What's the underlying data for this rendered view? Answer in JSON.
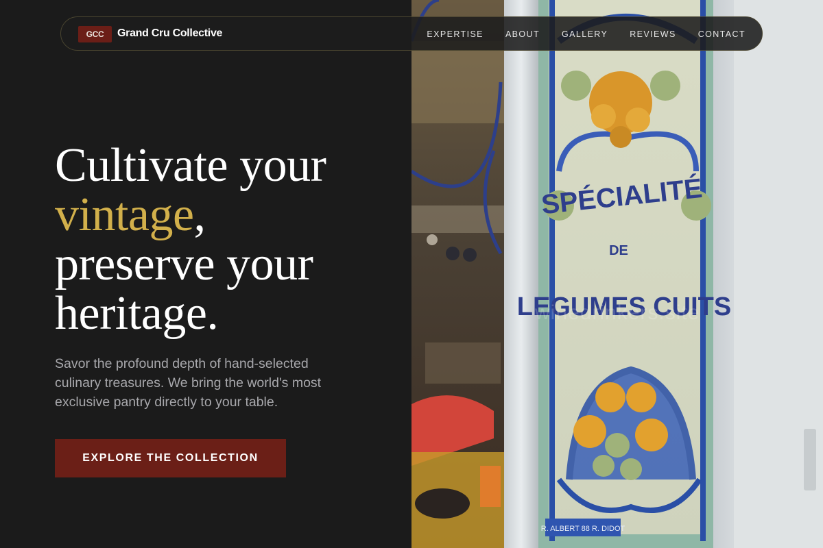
{
  "nav": {
    "logo_badge": "GCC",
    "brand": "Grand Cru Collective",
    "items": [
      {
        "label": "EXPERTISE"
      },
      {
        "label": "ABOUT"
      },
      {
        "label": "GALLERY"
      },
      {
        "label": "REVIEWS"
      },
      {
        "label": "CONTACT"
      }
    ]
  },
  "hero": {
    "line1": "Cultivate your",
    "accent_word": "vintage",
    "accent_punct": ",",
    "line3": "preserve your",
    "line4": "heritage.",
    "subtitle": "Savor the profound depth of hand-selected culinary treasures. We bring the world's most exclusive pantry directly to your table.",
    "cta_label": "EXPLORE THE COLLECTION"
  },
  "photo": {
    "sign_line1": "SPÉCIALITÉ",
    "sign_line2": "DE",
    "sign_line3": "LEGUMES CUITS",
    "plaque": "R. ALBERT 88 R. DIDOT",
    "watermark": "winedrinkers.site"
  },
  "colors": {
    "background": "#1b1b1b",
    "accent_gold": "#d2b04b",
    "cta_red": "#6b1f17",
    "subtitle_gray": "#a8a8ac"
  }
}
